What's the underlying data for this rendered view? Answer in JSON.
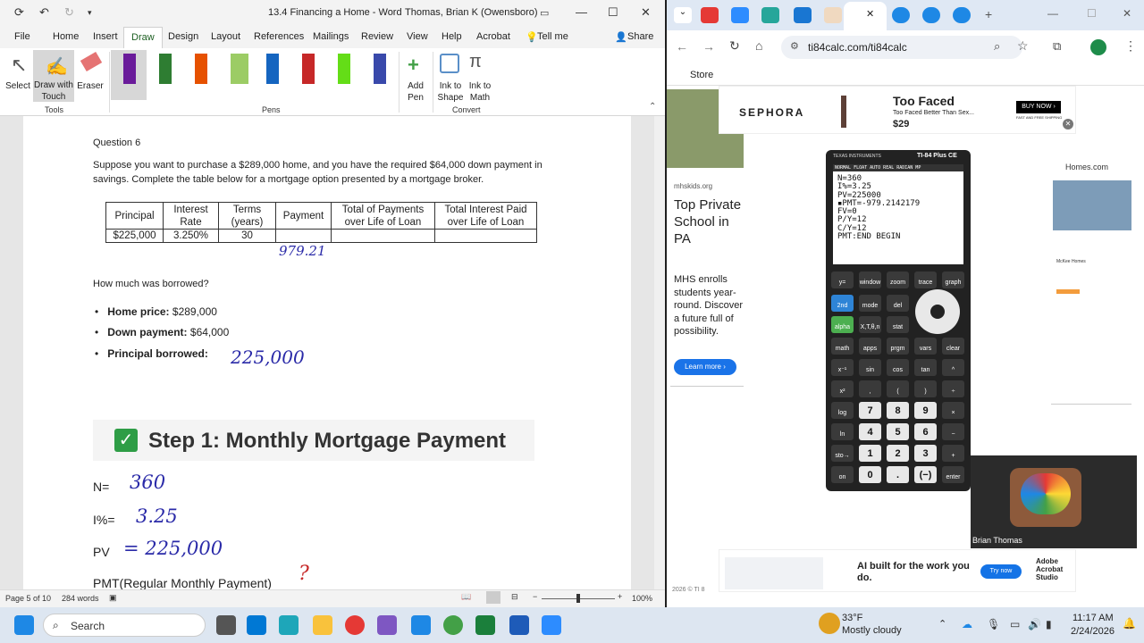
{
  "word": {
    "title": "13.4 Financing a Home  -  Word",
    "user": "Thomas, Brian K (Owensboro)",
    "menu": [
      "File",
      "Home",
      "Insert",
      "Draw",
      "Design",
      "Layout",
      "References",
      "Mailings",
      "Review",
      "View",
      "Help",
      "Acrobat"
    ],
    "tellme": "Tell me",
    "share": "Share",
    "ribbon": {
      "select": "Select",
      "draw_touch": "Draw with Touch",
      "eraser": "Eraser",
      "add_pen": "Add Pen",
      "ink_shape": "Ink to Shape",
      "ink_math": "Ink to Math",
      "groups": [
        "Tools",
        "Pens",
        "Convert"
      ],
      "pen_colors": [
        "#6a1b9a",
        "#2e7d32",
        "#e65100",
        "#9ccc65",
        "#1565c0",
        "#c62828",
        "#64dd17",
        "#3949ab"
      ]
    },
    "doc": {
      "question": "Question 6",
      "prompt1": "Suppose you want to purchase a $289,000 home, and you have the required $64,000 down payment in",
      "prompt2": "savings. Complete the table below for a mortgage option presented by a mortgage broker.",
      "table": {
        "headers": [
          "Principal",
          "Interest Rate",
          "Terms (years)",
          "Payment",
          "Total of Payments over Life of Loan",
          "Total Interest Paid over Life of Loan"
        ],
        "row": [
          "$225,000",
          "3.250%",
          "30",
          "",
          "",
          ""
        ]
      },
      "hand_payment": "979.21",
      "borrowed_q": "How much was borrowed?",
      "bullets": [
        {
          "label": "Home price:",
          "value": "$289,000"
        },
        {
          "label": "Down payment:",
          "value": "$64,000"
        },
        {
          "label": "Principal borrowed:",
          "value": ""
        }
      ],
      "hand_principal": "225,000",
      "step": "Step 1: Monthly Mortgage Payment",
      "vars": [
        {
          "label": "N=",
          "hand": "360"
        },
        {
          "label": "I%=",
          "hand": "3.25"
        },
        {
          "label": "PV",
          "hand": "= 225,000"
        },
        {
          "label": "PMT(Regular Monthly Payment)",
          "hand": "?"
        }
      ]
    },
    "status": {
      "page": "Page 5 of 10",
      "words": "284 words",
      "zoom": "100%"
    }
  },
  "chrome": {
    "url": "ti84calc.com/ti84calc",
    "bookmark": "Store",
    "ad_top": {
      "brand": "SEPHORA",
      "title": "Too Faced",
      "sub": "Too Faced Better Than Sex...",
      "price": "$29",
      "cta": "BUY NOW ›",
      "note": "FAST AND FREE SHIPPING"
    },
    "ad_left": {
      "site": "mhskids.org",
      "headline": "Top Private School in PA",
      "body": "MHS enrolls students year-round. Discover a future full of possibility.",
      "cta": "Learn more ›"
    },
    "ad_right": {
      "brand": "Homes.com",
      "name": "McKee Homes"
    },
    "ad_bottom": {
      "text": "AI built for the work you do.",
      "cta": "Try now",
      "brand": "Adobe Acrobat Studio"
    },
    "footer": "2026 © TI 8",
    "camera_name": "Brian Thomas"
  },
  "calc": {
    "brand": "TEXAS INSTRUMENTS",
    "model": "TI-84 Plus CE",
    "status_line": "NORMAL FLOAT AUTO REAL RADIAN MP",
    "lines": [
      "N=360",
      "I%=3.25",
      "PV=225000",
      "▪PMT=-979.2142179",
      "FV=0",
      "P/Y=12",
      "C/Y=12",
      "PMT:END  BEGIN"
    ],
    "rows": [
      [
        "y=",
        "window",
        "zoom",
        "trace",
        "graph"
      ],
      [
        "2nd",
        "mode",
        "del"
      ],
      [
        "alpha",
        "X,T,θ,n",
        "stat"
      ],
      [
        "math",
        "apps",
        "prgm",
        "vars",
        "clear"
      ],
      [
        "x⁻¹",
        "sin",
        "cos",
        "tan",
        "^"
      ],
      [
        "x²",
        ",",
        "(",
        ")",
        "÷"
      ],
      [
        "log",
        "7",
        "8",
        "9",
        "×"
      ],
      [
        "ln",
        "4",
        "5",
        "6",
        "−"
      ],
      [
        "sto→",
        "1",
        "2",
        "3",
        "+"
      ],
      [
        "on",
        "0",
        ".",
        "(−)",
        "enter"
      ]
    ]
  },
  "taskbar": {
    "search": "Search",
    "weather_temp": "33°F",
    "weather_desc": "Mostly cloudy",
    "time": "11:17 AM",
    "date": "2/24/2026"
  }
}
